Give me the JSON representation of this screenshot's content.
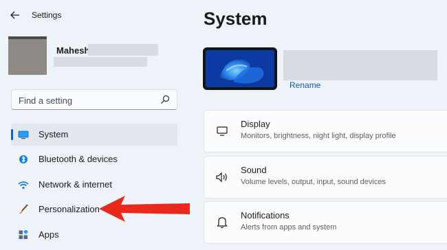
{
  "app": {
    "title": "Settings"
  },
  "profile": {
    "name": "Mahesh"
  },
  "search": {
    "placeholder": "Find a setting"
  },
  "sidebar": {
    "items": [
      {
        "label": "System",
        "icon": "monitor-icon",
        "active": true
      },
      {
        "label": "Bluetooth & devices",
        "icon": "bluetooth-icon"
      },
      {
        "label": "Network & internet",
        "icon": "wifi-icon"
      },
      {
        "label": "Personalization",
        "icon": "brush-icon"
      },
      {
        "label": "Apps",
        "icon": "apps-icon"
      }
    ]
  },
  "main": {
    "title": "System",
    "device": {
      "rename_label": "Rename"
    },
    "cards": [
      {
        "title": "Display",
        "subtitle": "Monitors, brightness, night light, display profile",
        "icon": "display-icon"
      },
      {
        "title": "Sound",
        "subtitle": "Volume levels, output, input, sound devices",
        "icon": "speaker-icon"
      },
      {
        "title": "Notifications",
        "subtitle": "Alerts from apps and system",
        "icon": "bell-icon"
      }
    ]
  },
  "colors": {
    "accent": "#0b62c9",
    "arrow": "#e8291c",
    "background": "#eef2f9",
    "card": "#fbfcfe"
  }
}
